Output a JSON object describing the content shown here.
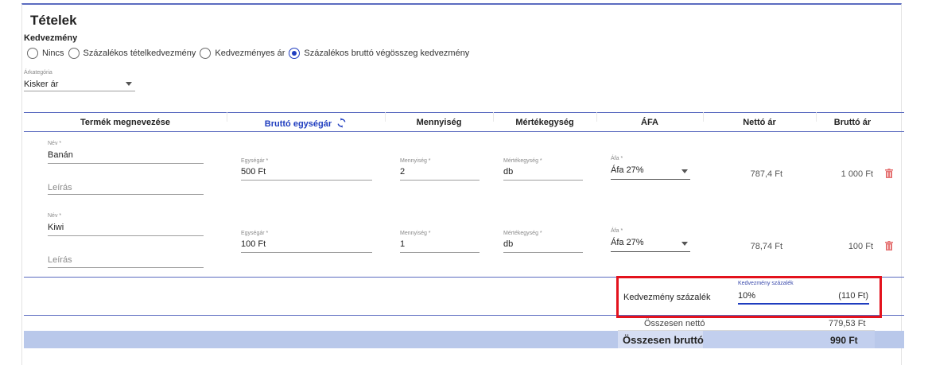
{
  "section": {
    "title": "Tételek"
  },
  "discount": {
    "label": "Kedvezmény",
    "options": [
      {
        "label": "Nincs",
        "selected": false
      },
      {
        "label": "Százalékos tételkedvezmény",
        "selected": false
      },
      {
        "label": "Kedvezményes ár",
        "selected": false
      },
      {
        "label": "Százalékos bruttó végösszeg kedvezmény",
        "selected": true
      }
    ]
  },
  "price_category": {
    "label": "Árkategória",
    "value": "Kisker ár"
  },
  "table": {
    "headers": {
      "name": "Termék megnevezése",
      "unit_price": "Bruttó egységár",
      "quantity": "Mennyiség",
      "unit": "Mértékegység",
      "vat": "ÁFA",
      "net": "Nettó ár",
      "gross": "Bruttó ár"
    },
    "rows": [
      {
        "name_label": "Név *",
        "name": "Banán",
        "desc_placeholder": "Leírás",
        "unit_price_label": "Egységár *",
        "unit_price": "500 Ft",
        "qty_label": "Mennyiség *",
        "qty": "2",
        "unit_label": "Mértékegység *",
        "unit": "db",
        "vat_label": "Áfa *",
        "vat": "Áfa 27%",
        "net": "787,4 Ft",
        "gross": "1 000 Ft"
      },
      {
        "name_label": "Név *",
        "name": "Kiwi",
        "desc_placeholder": "Leírás",
        "unit_price_label": "Egységár *",
        "unit_price": "100 Ft",
        "qty_label": "Mennyiség *",
        "qty": "1",
        "unit_label": "Mértékegység *",
        "unit": "db",
        "vat_label": "Áfa *",
        "vat": "Áfa 27%",
        "net": "78,74 Ft",
        "gross": "100 Ft"
      }
    ]
  },
  "discount_percent": {
    "row_label": "Kedvezmény százalék",
    "field_label": "Kedvezmény százalék",
    "value": "10%",
    "amount": "(110 Ft)"
  },
  "totals": {
    "net_label": "Összesen nettó",
    "net_value": "779,53 Ft",
    "gross_label": "Összesen bruttó",
    "gross_value": "990 Ft"
  },
  "colors": {
    "accent": "#1f3dbf",
    "highlight": "#e3121d",
    "delete": "#e57373",
    "total_bg": "#b9c8ea"
  },
  "icons": {
    "sync": "sync-icon",
    "delete": "trash-icon",
    "dropdown": "chevron-down-icon"
  }
}
